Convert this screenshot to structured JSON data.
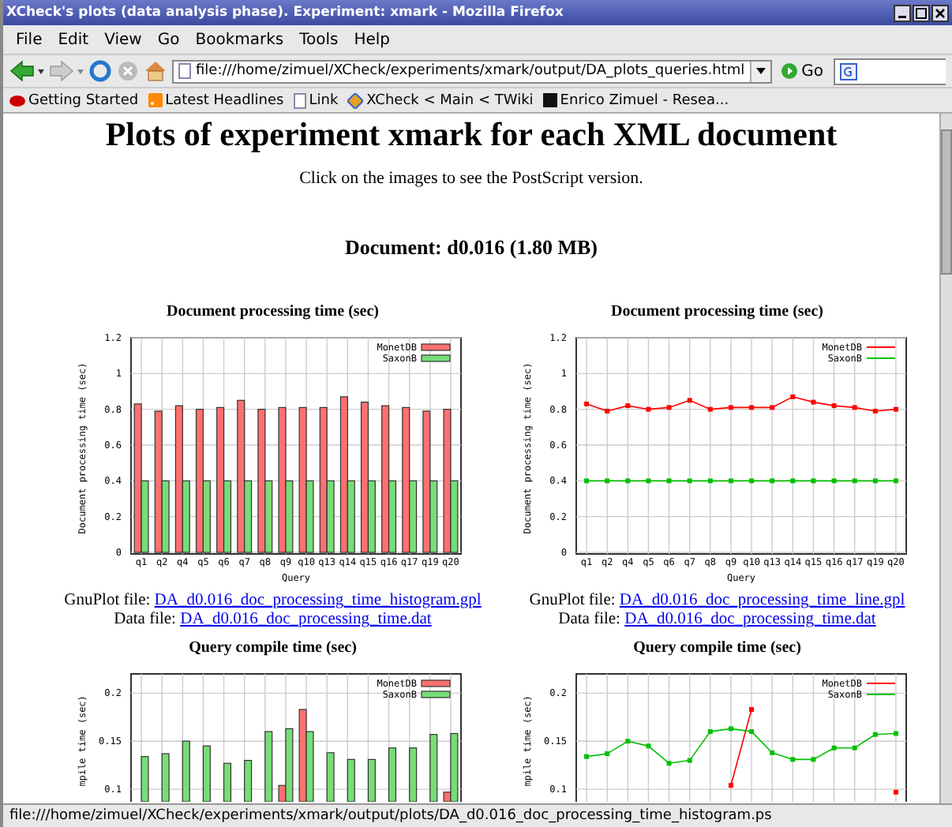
{
  "window": {
    "title": "XCheck's plots (data analysis phase). Experiment: xmark - Mozilla Firefox"
  },
  "menu": [
    "File",
    "Edit",
    "View",
    "Go",
    "Bookmarks",
    "Tools",
    "Help"
  ],
  "toolbar": {
    "address": "file:///home/zimuel/XCheck/experiments/xmark/output/DA_plots_queries.html",
    "go": "Go"
  },
  "bookmarks": [
    "Getting Started",
    "Latest Headlines",
    "Link",
    "XCheck < Main < TWiki",
    "Enrico Zimuel - Resea..."
  ],
  "page": {
    "heading": "Plots of experiment xmark for each XML document",
    "subtitle": "Click on the images to see the PostScript version.",
    "document": "Document: d0.016 (1.80 MB)",
    "plots": [
      {
        "chart_data": {
          "type": "bar",
          "title": "Document processing time (sec)",
          "xlabel": "Query",
          "ylabel": "Document processing time (sec)",
          "grid": true,
          "legend": true,
          "categories": [
            "q1",
            "q2",
            "q4",
            "q5",
            "q6",
            "q7",
            "q8",
            "q9",
            "q10",
            "q13",
            "q14",
            "q15",
            "q16",
            "q17",
            "q19",
            "q20"
          ],
          "series": [
            {
              "name": "MonetDB",
              "color": "#ff7070",
              "values": [
                0.83,
                0.79,
                0.82,
                0.8,
                0.81,
                0.85,
                0.8,
                0.81,
                0.81,
                0.81,
                0.87,
                0.84,
                0.82,
                0.81,
                0.79,
                0.8
              ]
            },
            {
              "name": "SaxonB",
              "color": "#77dd77",
              "values": [
                0.4,
                0.4,
                0.4,
                0.4,
                0.4,
                0.4,
                0.4,
                0.4,
                0.4,
                0.4,
                0.4,
                0.4,
                0.4,
                0.4,
                0.4,
                0.4
              ]
            }
          ],
          "ylim": [
            0,
            1.2
          ],
          "yticks": [
            {
              "value": 0,
              "label": "0"
            },
            {
              "value": 0.2,
              "label": "0.2"
            },
            {
              "value": 0.4,
              "label": "0.4"
            },
            {
              "value": 0.6,
              "label": "0.6"
            },
            {
              "value": 0.8,
              "label": "0.8"
            },
            {
              "value": 1,
              "label": "1"
            },
            {
              "value": 1.2,
              "label": "1.2"
            }
          ]
        },
        "gnuplot_label": "GnuPlot file:",
        "gnuplot_file": "DA_d0.016_doc_processing_time_histogram.gpl",
        "data_label": "Data file:",
        "data_file": "DA_d0.016_doc_processing_time.dat"
      },
      {
        "chart_data": {
          "type": "line",
          "title": "Document processing time (sec)",
          "xlabel": "Query",
          "ylabel": "Document processing time (sec)",
          "grid": true,
          "legend": true,
          "categories": [
            "q1",
            "q2",
            "q4",
            "q5",
            "q6",
            "q7",
            "q8",
            "q9",
            "q10",
            "q13",
            "q14",
            "q15",
            "q16",
            "q17",
            "q19",
            "q20"
          ],
          "series": [
            {
              "name": "MonetDB",
              "color": "#ff0000",
              "marker": "square",
              "values": [
                0.83,
                0.79,
                0.82,
                0.8,
                0.81,
                0.85,
                0.8,
                0.81,
                0.81,
                0.81,
                0.87,
                0.84,
                0.82,
                0.81,
                0.79,
                0.8
              ]
            },
            {
              "name": "SaxonB",
              "color": "#00c000",
              "marker": "square",
              "values": [
                0.4,
                0.4,
                0.4,
                0.4,
                0.4,
                0.4,
                0.4,
                0.4,
                0.4,
                0.4,
                0.4,
                0.4,
                0.4,
                0.4,
                0.4,
                0.4
              ]
            }
          ],
          "ylim": [
            0,
            1.2
          ],
          "yticks": [
            {
              "value": 0,
              "label": "0"
            },
            {
              "value": 0.2,
              "label": "0.2"
            },
            {
              "value": 0.4,
              "label": "0.4"
            },
            {
              "value": 0.6,
              "label": "0.6"
            },
            {
              "value": 0.8,
              "label": "0.8"
            },
            {
              "value": 1,
              "label": "1"
            },
            {
              "value": 1.2,
              "label": "1.2"
            }
          ]
        },
        "gnuplot_label": "GnuPlot file:",
        "gnuplot_file": "DA_d0.016_doc_processing_time_line.gpl",
        "data_label": "Data file:",
        "data_file": "DA_d0.016_doc_processing_time.dat"
      },
      {
        "chart_data": {
          "type": "bar",
          "title": "Query compile time (sec)",
          "ylabel": "mpile time (sec)",
          "grid": true,
          "legend": true,
          "series": [
            {
              "name": "MonetDB",
              "color": "#ff7070",
              "values": [
                null,
                null,
                null,
                null,
                null,
                null,
                null,
                0.104,
                0.183,
                null,
                null,
                null,
                null,
                null,
                null,
                0.097
              ]
            },
            {
              "name": "SaxonB",
              "color": "#77dd77",
              "values": [
                0.134,
                0.137,
                0.15,
                0.145,
                0.127,
                0.13,
                0.16,
                0.163,
                0.16,
                0.138,
                0.131,
                0.131,
                0.143,
                0.143,
                0.157,
                0.158
              ]
            }
          ],
          "ylim": [
            0.087,
            0.22
          ],
          "yticks": [
            {
              "value": 0.1,
              "label": "0.1"
            },
            {
              "value": 0.15,
              "label": "0.15"
            },
            {
              "value": 0.2,
              "label": "0.2"
            }
          ]
        }
      },
      {
        "chart_data": {
          "type": "line",
          "title": "Query compile time (sec)",
          "ylabel": "mpile time (sec)",
          "grid": true,
          "legend": true,
          "series": [
            {
              "name": "MonetDB",
              "color": "#ff0000",
              "marker": "square",
              "values": [
                null,
                null,
                null,
                null,
                null,
                null,
                null,
                0.104,
                0.183,
                null,
                null,
                null,
                null,
                null,
                null,
                0.097
              ]
            },
            {
              "name": "SaxonB",
              "color": "#00c000",
              "marker": "square",
              "values": [
                0.134,
                0.137,
                0.15,
                0.145,
                0.127,
                0.13,
                0.16,
                0.163,
                0.16,
                0.138,
                0.131,
                0.131,
                0.143,
                0.143,
                0.157,
                0.158
              ]
            }
          ],
          "ylim": [
            0.087,
            0.22
          ],
          "yticks": [
            {
              "value": 0.1,
              "label": "0.1"
            },
            {
              "value": 0.15,
              "label": "0.15"
            },
            {
              "value": 0.2,
              "label": "0.2"
            }
          ]
        }
      }
    ]
  },
  "status_bar": "file:///home/zimuel/XCheck/experiments/xmark/output/plots/DA_d0.016_doc_processing_time_histogram.ps"
}
